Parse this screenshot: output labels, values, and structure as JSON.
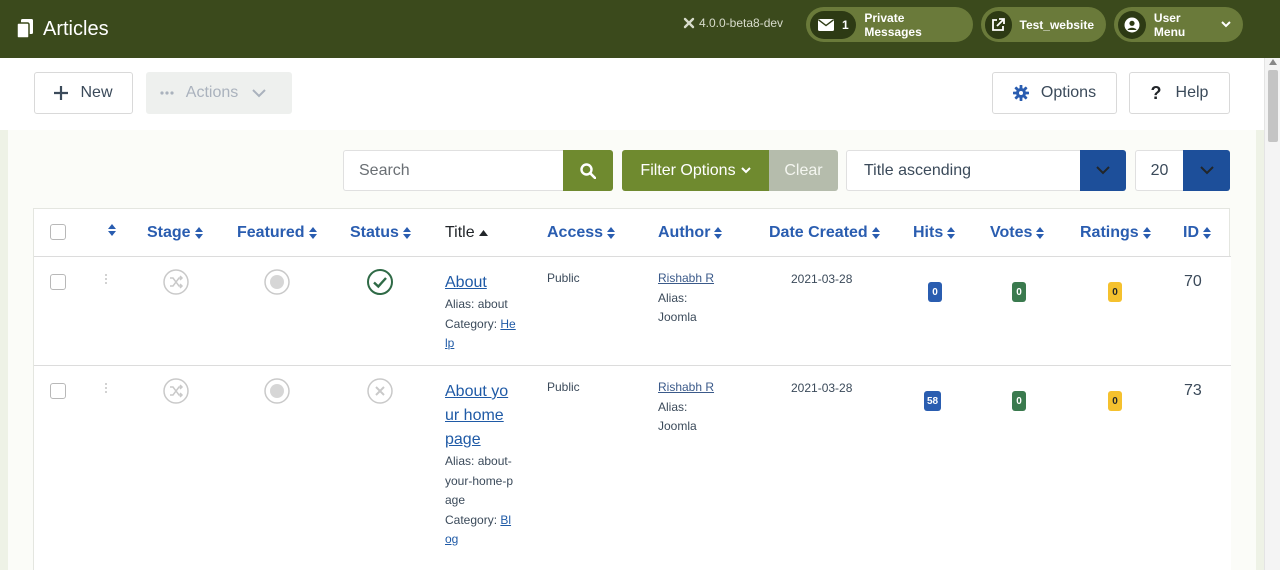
{
  "header": {
    "title": "Articles",
    "version": "4.0.0-beta8-dev",
    "messages_count": "1",
    "messages_label": "Private Messages",
    "site_label": "Test_website",
    "user_label": "User Menu",
    "bg_color": "#3b4a1c"
  },
  "toolbar": {
    "new_label": "New",
    "actions_label": "Actions",
    "options_label": "Options",
    "help_label": "Help"
  },
  "filters": {
    "search_placeholder": "Search",
    "filter_options_label": "Filter Options",
    "clear_label": "Clear",
    "sort_value": "Title ascending",
    "limit_value": "20"
  },
  "table": {
    "columns": {
      "stage": "Stage",
      "featured": "Featured",
      "status": "Status",
      "title": "Title",
      "access": "Access",
      "author": "Author",
      "date_created": "Date Created",
      "hits": "Hits",
      "votes": "Votes",
      "ratings": "Ratings",
      "id": "ID"
    },
    "rows": [
      {
        "title": "About",
        "alias_label": "Alias:",
        "alias": "about",
        "category_label": "Category:",
        "category": "Help",
        "access": "Public",
        "author": "Rishabh R",
        "author_alias_label": "Alias:",
        "author_alias": "Joomla",
        "date": "2021-03-28",
        "hits": "0",
        "votes": "0",
        "ratings": "0",
        "id": "70",
        "status": "published"
      },
      {
        "title": "About your home page",
        "alias_label": "Alias:",
        "alias": "about-your-home-page",
        "category_label": "Category:",
        "category": "Blog",
        "access": "Public",
        "author": "Rishabh R",
        "author_alias_label": "Alias:",
        "author_alias": "Joomla",
        "date": "2021-03-28",
        "hits": "58",
        "votes": "0",
        "ratings": "0",
        "id": "73",
        "status": "unpublished"
      }
    ]
  },
  "colors": {
    "accent_green": "#6f8a2f",
    "accent_blue": "#1d4f9a",
    "link_blue": "#2a5db0"
  }
}
